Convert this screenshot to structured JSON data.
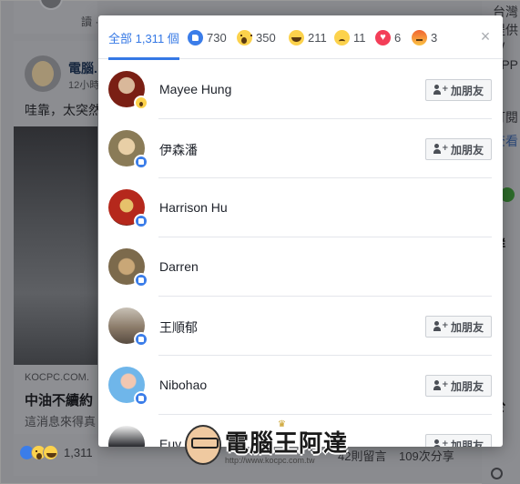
{
  "background": {
    "top_reply": "讀 · 回",
    "post": {
      "author": "電腦.",
      "time": "12小時",
      "text": "哇靠，太突然",
      "link_domain": "KOCPC.COM.",
      "link_title": "中油不續約",
      "link_desc": "這消息來得真",
      "reaction_count": "1,311",
      "comments": "42則留言",
      "shares": "109次分享"
    },
    "right_column": {
      "lines": [
        "台灣",
        "提供",
        "W",
        "PPP",
        "P",
        "訂閱",
        "查看"
      ],
      "group_heading": "群",
      "bottom_heading": "於"
    }
  },
  "dialog": {
    "tabs": [
      {
        "label": "全部 1,311 個",
        "reaction": null
      },
      {
        "label": "730",
        "reaction": "like"
      },
      {
        "label": "350",
        "reaction": "wow"
      },
      {
        "label": "211",
        "reaction": "haha"
      },
      {
        "label": "11",
        "reaction": "sad"
      },
      {
        "label": "6",
        "reaction": "love"
      },
      {
        "label": "3",
        "reaction": "angry"
      }
    ],
    "close_icon": "×",
    "add_friend_label": "加朋友",
    "people": [
      {
        "name": "Mayee Hung",
        "reaction": "wow",
        "has_add_button": true
      },
      {
        "name": "伊森潘",
        "reaction": "like",
        "has_add_button": true
      },
      {
        "name": "Harrison Hu",
        "reaction": "like",
        "has_add_button": false
      },
      {
        "name": "Darren",
        "reaction": "like",
        "has_add_button": false
      },
      {
        "name": "王順郁",
        "reaction": "like",
        "has_add_button": true
      },
      {
        "name": "Nibohao",
        "reaction": "like",
        "has_add_button": true
      },
      {
        "name": "Euv",
        "reaction": "like",
        "has_add_button": true
      }
    ]
  },
  "watermark": {
    "title": "電腦王阿達",
    "url": "http://www.kocpc.com.tw"
  },
  "colors": {
    "accent": "#3578e5",
    "like": "#3b7de9",
    "love": "#f33e58",
    "emoji_yellow": "#fcd24c",
    "overlay": "#8a8b8f"
  }
}
